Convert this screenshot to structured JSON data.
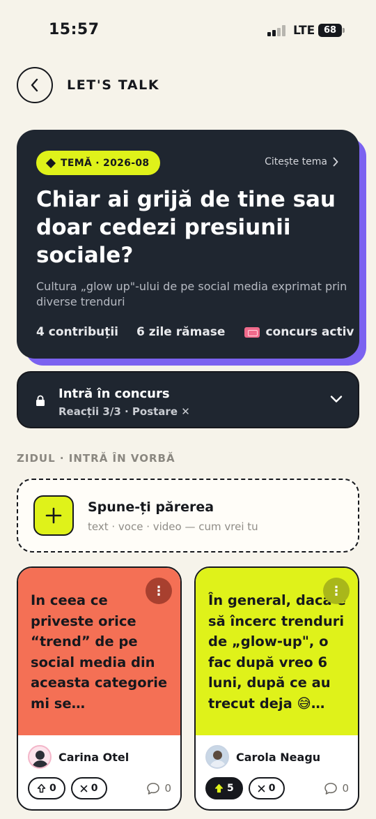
{
  "status_bar": {
    "time": "15:57",
    "network": "LTE",
    "battery": "68"
  },
  "header": {
    "title": "LET'S TALK",
    "back_icon": "chevron-left-icon"
  },
  "theme": {
    "badge": "TEMĂ · 2026-08",
    "read_link": "Citește tema",
    "title": "Chiar ai grijă de tine sau doar cedezi presiunii sociale?",
    "subtitle": "Cultura „glow up\"-ului de pe social media exprimat prin diverse trenduri",
    "stats": {
      "contributions": "4 contribuții",
      "days_left": "6 zile rămase",
      "contest": "concurs activ"
    },
    "accent_color": "#dff21a",
    "shadow_color": "#7b62f0"
  },
  "contest": {
    "title": "Intră în concurs",
    "subtitle": "Reacții 3/3 · Postare ✕"
  },
  "wall": {
    "section_label": "ZIDUL · INTRĂ ÎN VORBĂ"
  },
  "compose": {
    "title": "Spune-ți părerea",
    "subtitle": "text · voce · video — cum vrei tu"
  },
  "posts": [
    {
      "text": "In ceea ce priveste orice “trend” de pe social media din aceasta categorie mi se…",
      "author": "Carina Otel",
      "upvotes": "0",
      "downvotes": "0",
      "comments": "0",
      "color": "#f47055"
    },
    {
      "text": "În general, dacă e să încerc trenduri de „glow-up\", o fac după vreo 6 luni, după ce au trecut deja 😅…",
      "author": "Carola Neagu",
      "upvotes": "5",
      "downvotes": "0",
      "comments": "0",
      "color": "#dff21a"
    }
  ]
}
